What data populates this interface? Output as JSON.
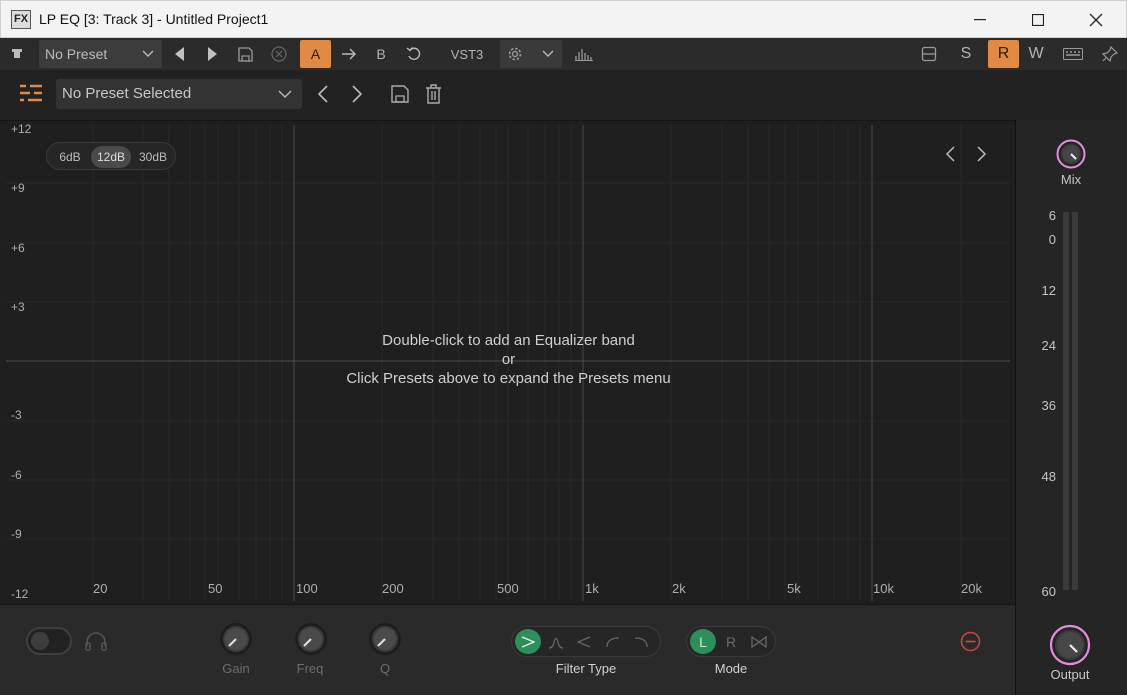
{
  "window": {
    "badge": "FX",
    "title": "LP EQ [3: Track 3] - Untitled Project1"
  },
  "hostbar": {
    "preset": "No Preset",
    "a_label": "A",
    "b_label": "B",
    "format": "VST3",
    "s_label": "S",
    "r_label": "R",
    "w_label": "W"
  },
  "plugin": {
    "preset": "No Preset Selected"
  },
  "eq": {
    "ranges": [
      "6dB",
      "12dB",
      "30dB"
    ],
    "active_range": "12dB",
    "db_labels": [
      "+12",
      "+9",
      "+6",
      "+3",
      "-3",
      "-6",
      "-9",
      "-12"
    ],
    "freq_labels": [
      "20",
      "50",
      "100",
      "200",
      "500",
      "1k",
      "2k",
      "5k",
      "10k",
      "20k"
    ],
    "hint_line1": "Double-click to add an Equalizer band",
    "hint_line2": "or",
    "hint_line3": "Click Presets above to expand the Presets menu"
  },
  "right": {
    "mix_label": "Mix",
    "meter_scale": [
      "6",
      "0",
      "12",
      "24",
      "36",
      "48",
      "60"
    ],
    "output_label": "Output"
  },
  "bottom": {
    "gain_label": "Gain",
    "freq_label": "Freq",
    "q_label": "Q",
    "filter_type_label": "Filter Type",
    "mode_label": "Mode",
    "mode_options": [
      "L",
      "R"
    ]
  },
  "colors": {
    "accent_orange": "#e08a45",
    "accent_green": "#2e8f5a",
    "knob_pink": "#e58be0",
    "remove_red": "#d04545"
  }
}
